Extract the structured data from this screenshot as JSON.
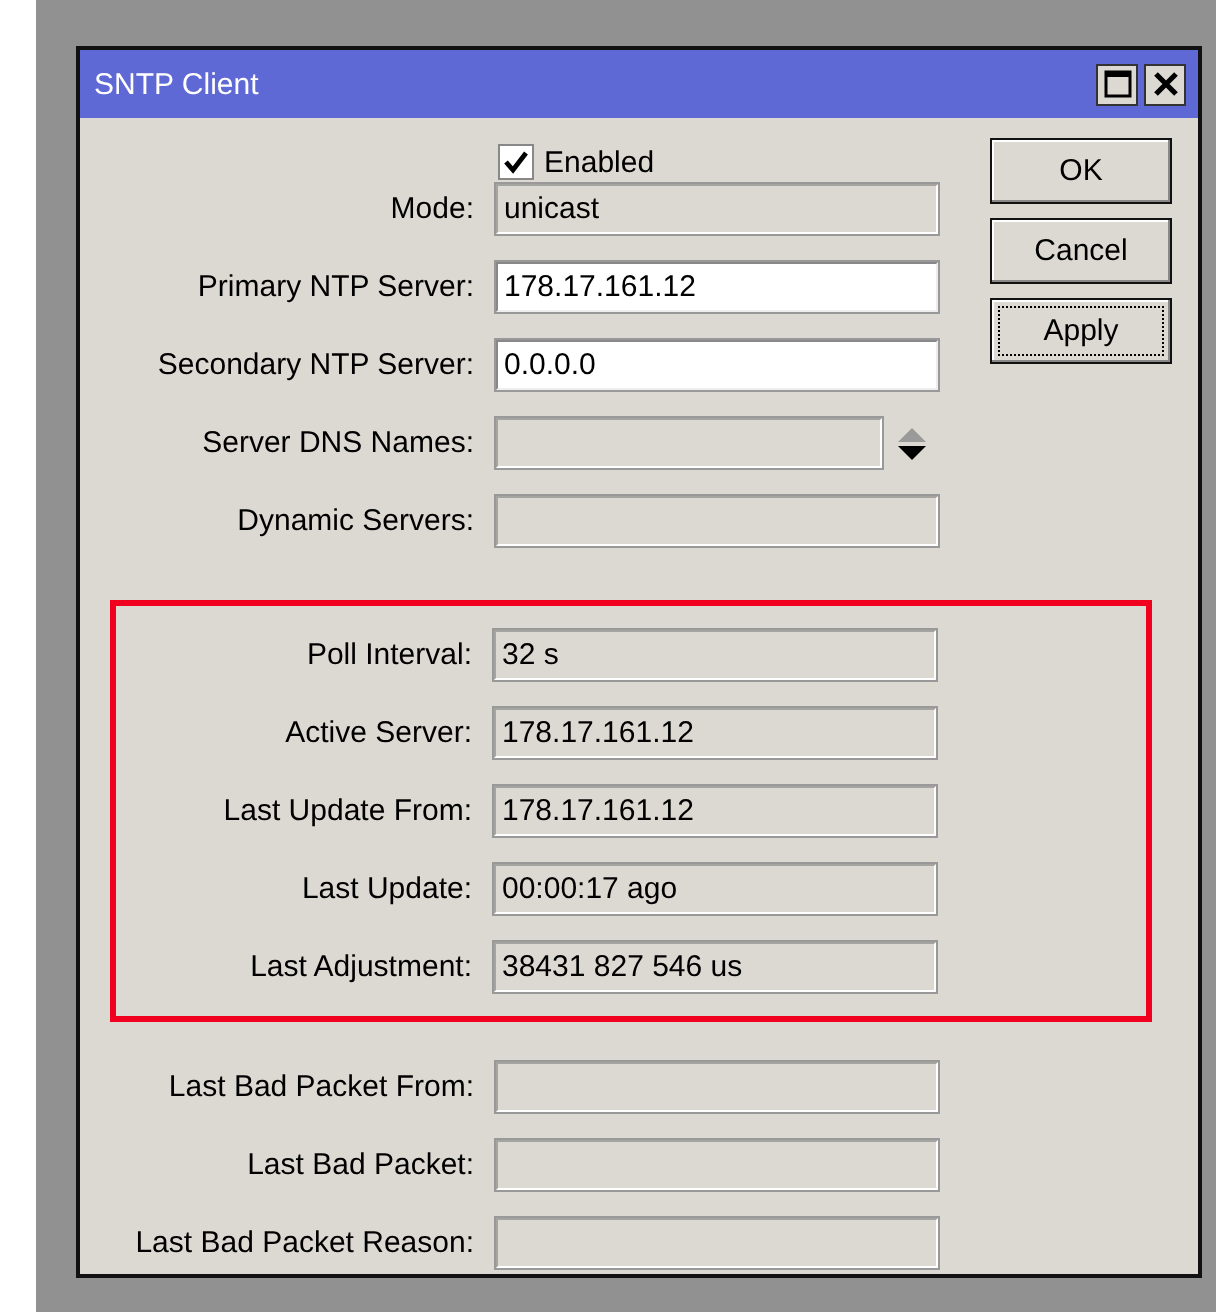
{
  "window": {
    "title": "SNTP Client"
  },
  "enabled": {
    "label": "Enabled",
    "checked": true
  },
  "fields": [
    {
      "label": "Mode:",
      "value": "unicast",
      "editable": false,
      "kind": "text"
    },
    {
      "label": "Primary NTP Server:",
      "value": "178.17.161.12",
      "editable": true,
      "kind": "text"
    },
    {
      "label": "Secondary NTP Server:",
      "value": "0.0.0.0",
      "editable": true,
      "kind": "text"
    },
    {
      "label": "Server DNS Names:",
      "editable": false,
      "kind": "list"
    },
    {
      "label": "Dynamic Servers:",
      "editable": false,
      "kind": "text"
    }
  ],
  "highlighted_fields": [
    {
      "label": "Poll Interval:",
      "value": "32 s",
      "editable": false,
      "kind": "text"
    },
    {
      "label": "Active Server:",
      "value": "178.17.161.12",
      "editable": false,
      "kind": "text"
    },
    {
      "label": "Last Update From:",
      "value": "178.17.161.12",
      "editable": false,
      "kind": "text"
    },
    {
      "label": "Last Update:",
      "value": "00:00:17 ago",
      "editable": false,
      "kind": "text"
    },
    {
      "label": "Last Adjustment:",
      "value": "38431 827 546 us",
      "editable": false,
      "kind": "text"
    }
  ],
  "bad_packet_fields": [
    {
      "label": "Last Bad Packet From:",
      "editable": false,
      "kind": "text"
    },
    {
      "label": "Last Bad Packet:",
      "editable": false,
      "kind": "text"
    },
    {
      "label": "Last Bad Packet Reason:",
      "editable": false,
      "kind": "text"
    }
  ],
  "buttons": [
    {
      "label": "OK",
      "focused": false
    },
    {
      "label": "Cancel",
      "focused": false
    },
    {
      "label": "Apply",
      "focused": true
    }
  ]
}
